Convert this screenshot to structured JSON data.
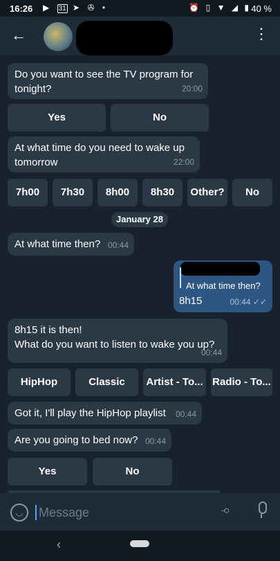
{
  "status_bar": {
    "time": "16:26",
    "left_icons": [
      "play-icon",
      "calendar-icon",
      "send-icon",
      "signal-icon",
      "dot-icon"
    ],
    "right_icons": [
      "alarm-icon",
      "vibrate-icon",
      "wifi-icon",
      "cell-signal-icon",
      "battery-icon"
    ],
    "calendar_day": "31",
    "battery": "40 %"
  },
  "header": {
    "back_icon": "arrow-left-icon",
    "menu_icon": "more-vertical-icon"
  },
  "messages": {
    "m1": {
      "text": "Do you want to see the TV program for\ntonight?",
      "time": "20:00"
    },
    "kb1": [
      "Yes",
      "No"
    ],
    "m2": {
      "text": "At what time do you need to wake up\ntomorrow",
      "time": "22:00"
    },
    "kb2": [
      "7h00",
      "7h30",
      "8h00",
      "8h30",
      "Other?",
      "No"
    ],
    "date": "January 28",
    "m3": {
      "text": "At what time then?",
      "time": "00:44"
    },
    "out1": {
      "reply_quote": "At what time then?",
      "text": "8h15",
      "time": "00:44",
      "ticks": "✓✓"
    },
    "m4": {
      "text": "8h15 it is then!\nWhat do you want to listen to wake you up?",
      "time": "00:44"
    },
    "kb3": [
      "HipHop",
      "Classic",
      "Artist - To...",
      "Radio - To..."
    ],
    "m5": {
      "text": "Got it, I'll play the HipHop playlist",
      "time": "00:44"
    },
    "m6": {
      "text": "Are you going to bed now?",
      "time": "00:44"
    },
    "kb4": [
      "Yes",
      "No"
    ]
  },
  "input": {
    "placeholder": "Message",
    "emoji_icon": "smile-icon",
    "attach_icon": "paperclip-icon",
    "mic_icon": "microphone-icon"
  },
  "nav": {
    "back_icon": "chevron-left-icon",
    "home_icon": "home-pill-icon"
  }
}
